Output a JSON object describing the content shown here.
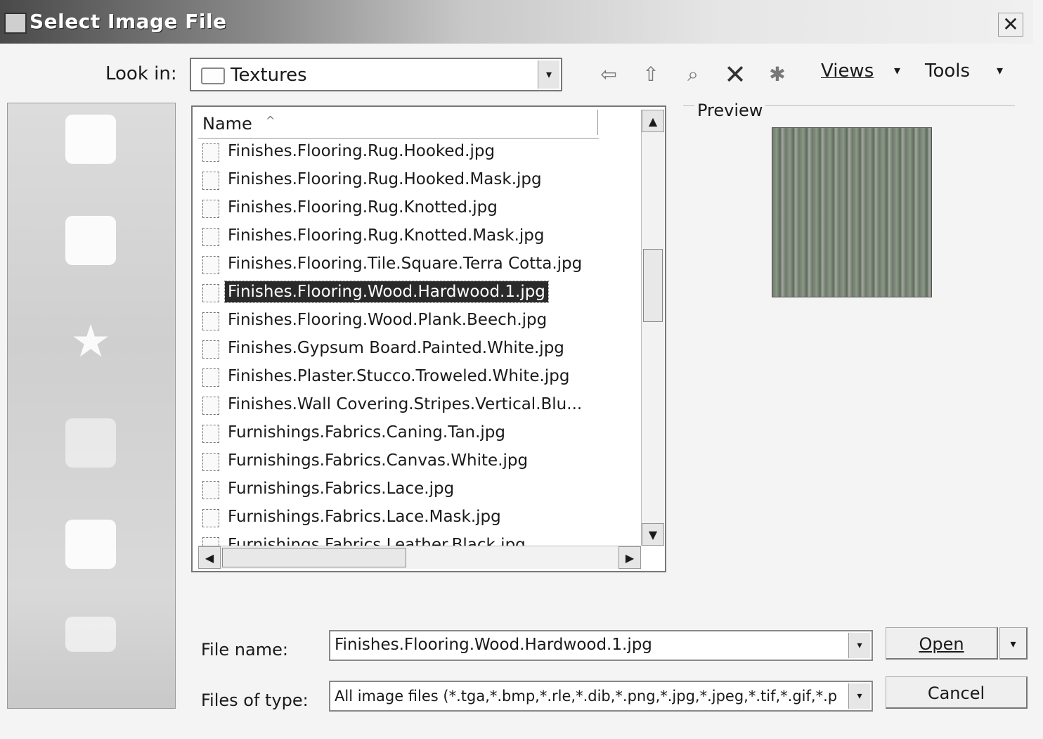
{
  "window": {
    "title": "Select Image File",
    "close_glyph": "✕"
  },
  "toolbar": {
    "lookin_label": "Look in:",
    "lookin_value": "Textures",
    "back_icon": "⇦",
    "up_icon": "⇧",
    "search_icon": "⌕",
    "delete_icon": "✕",
    "newfolder_icon": "✱",
    "views_label": "Views",
    "tools_label": "Tools",
    "dropdown_glyph": "▾"
  },
  "places": [
    {
      "icon": "history-icon"
    },
    {
      "icon": "documents-icon"
    },
    {
      "icon": "favorites-icon"
    },
    {
      "icon": "desktop-icon"
    },
    {
      "icon": "network-icon"
    },
    {
      "icon": "buzzsaw-icon"
    }
  ],
  "filelist": {
    "column_name": "Name",
    "sort_glyph": "^",
    "rows": [
      {
        "name": "Finishes.Flooring.Rug.Hooked.jpg",
        "selected": false
      },
      {
        "name": "Finishes.Flooring.Rug.Hooked.Mask.jpg",
        "selected": false
      },
      {
        "name": "Finishes.Flooring.Rug.Knotted.jpg",
        "selected": false
      },
      {
        "name": "Finishes.Flooring.Rug.Knotted.Mask.jpg",
        "selected": false
      },
      {
        "name": "Finishes.Flooring.Tile.Square.Terra Cotta.jpg",
        "selected": false
      },
      {
        "name": "Finishes.Flooring.Wood.Hardwood.1.jpg",
        "selected": true
      },
      {
        "name": "Finishes.Flooring.Wood.Plank.Beech.jpg",
        "selected": false
      },
      {
        "name": "Finishes.Gypsum Board.Painted.White.jpg",
        "selected": false
      },
      {
        "name": "Finishes.Plaster.Stucco.Troweled.White.jpg",
        "selected": false
      },
      {
        "name": "Finishes.Wall Covering.Stripes.Vertical.Blu...",
        "selected": false
      },
      {
        "name": "Furnishings.Fabrics.Caning.Tan.jpg",
        "selected": false
      },
      {
        "name": "Furnishings.Fabrics.Canvas.White.jpg",
        "selected": false
      },
      {
        "name": "Furnishings.Fabrics.Lace.jpg",
        "selected": false
      },
      {
        "name": "Furnishings.Fabrics.Lace.Mask.jpg",
        "selected": false
      },
      {
        "name": "Furnishings.Fabrics.Leather.Black.jpg",
        "selected": false
      }
    ],
    "scroll_up_glyph": "▲",
    "scroll_down_glyph": "▼",
    "scroll_left_glyph": "◀",
    "scroll_right_glyph": "▶"
  },
  "preview": {
    "label": "Preview"
  },
  "bottom": {
    "filename_label": "File name:",
    "filename_value": "Finishes.Flooring.Wood.Hardwood.1.jpg",
    "filetype_label": "Files of type:",
    "filetype_value": "All image files (*.tga,*.bmp,*.rle,*.dib,*.png,*.jpg,*.jpeg,*.tif,*.gif,*.p",
    "open_label": "Open",
    "cancel_label": "Cancel",
    "dropdown_glyph": "▾"
  }
}
